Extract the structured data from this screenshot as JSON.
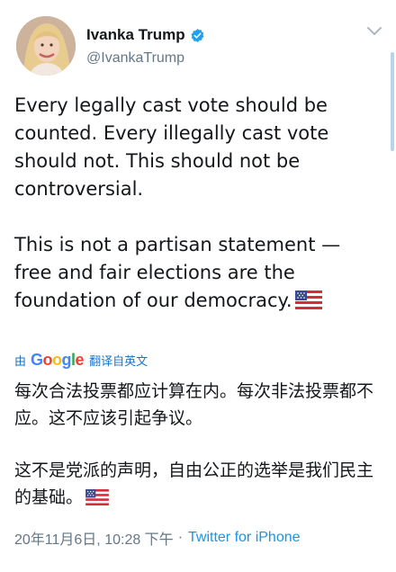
{
  "tweet": {
    "author": {
      "name": "Ivanka Trump",
      "handle": "@IvankaTrump",
      "verified": true
    },
    "text": {
      "paragraph1": "Every legally cast vote should be counted. Every illegally cast vote should not. This should not be controversial.",
      "paragraph2": "This is not a partisan statement — free and fair elections are the foundation of our democracy.",
      "paragraph2_emoji": "us-flag"
    },
    "translation": {
      "prefix": "由",
      "provider": "Google",
      "action": "翻译自英文",
      "paragraph1": "每次合法投票都应计算在内。每次非法投票都不应。这不应该引起争议。",
      "paragraph2": "这不是党派的声明，自由公正的选举是我们民主的基础。",
      "paragraph2_emoji": "us-flag"
    },
    "timestamp": "20年11月6日, 10:28 下午",
    "separator": "·",
    "source": "Twitter for iPhone"
  },
  "colors": {
    "link_blue": "#1b95e0",
    "translate_blue": "#1b73c3",
    "muted_gray": "#657786",
    "text_dark": "#14171a",
    "verified_blue": "#1da1f2"
  },
  "icons": {
    "verified": "verified-badge-icon",
    "menu": "chevron-down-icon",
    "flag": "us-flag-icon"
  }
}
